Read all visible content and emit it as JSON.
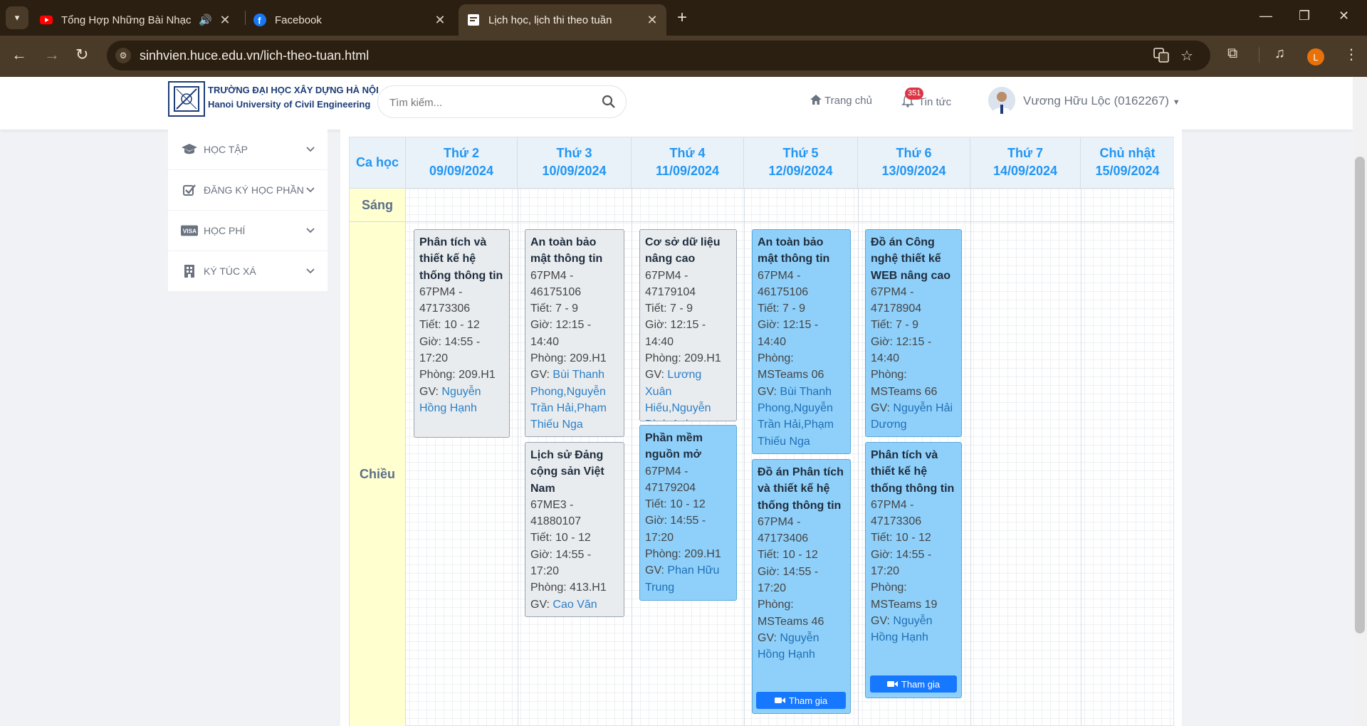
{
  "browser": {
    "tabs": [
      {
        "title": "Tổng Hợp Những Bài Nhạc",
        "icon": "youtube-icon",
        "audio": true
      },
      {
        "title": "Facebook",
        "icon": "facebook-icon"
      },
      {
        "title": "Lịch học, lịch thi theo tuần",
        "icon": "page-icon",
        "active": true
      }
    ],
    "url": "sinhvien.huce.edu.vn/lich-theo-tuan.html",
    "profile_initial": "L"
  },
  "site": {
    "logo_line1": "TRƯỜNG ĐẠI HỌC XÂY DỰNG HÀ NỘI",
    "logo_line2": "Hanoi University of Civil Engineering",
    "search_placeholder": "Tìm kiếm...",
    "nav_home": "Trang chủ",
    "nav_news": "Tin tức",
    "news_count": "351",
    "user_name": "Vương Hữu Lộc (0162267)"
  },
  "sidebar": {
    "items": [
      {
        "label": "HỌC TẬP",
        "icon": "graduation-cap-icon"
      },
      {
        "label": "ĐĂNG KÝ HỌC PHẦN",
        "icon": "checkbox-icon"
      },
      {
        "label": "HỌC PHÍ",
        "icon": "visa-card-icon"
      },
      {
        "label": "KÝ TÚC XÁ",
        "icon": "building-icon"
      }
    ]
  },
  "timetable": {
    "corner": "Ca học",
    "days": [
      {
        "day": "Thứ 2",
        "date": "09/09/2024"
      },
      {
        "day": "Thứ 3",
        "date": "10/09/2024"
      },
      {
        "day": "Thứ 4",
        "date": "11/09/2024"
      },
      {
        "day": "Thứ 5",
        "date": "12/09/2024"
      },
      {
        "day": "Thứ 6",
        "date": "13/09/2024"
      },
      {
        "day": "Thứ 7",
        "date": "14/09/2024"
      },
      {
        "day": "Chủ nhật",
        "date": "15/09/2024"
      }
    ],
    "sessions": {
      "morning": "Sáng",
      "afternoon": "Chiều"
    },
    "join_label": "Tham gia",
    "classes": [
      {
        "title": "Phân tích và thiết kế hệ thống thông tin",
        "code": "67PM4 - 47173306",
        "period": "Tiết: 10 - 12",
        "time": "Giờ: 14:55 - 17:20",
        "room": "Phòng: 209.H1",
        "gv_prefix": "GV: ",
        "gv": "Nguyễn Hồng Hạnh"
      },
      {
        "title": "An toàn bảo mật thông tin",
        "code": "67PM4 - 46175106",
        "period": "Tiết: 7 - 9",
        "time": "Giờ: 12:15 - 14:40",
        "room": "Phòng: 209.H1",
        "gv_prefix": "GV: ",
        "gv": "Bùi Thanh Phong,Nguyễn Trần Hải,Phạm Thiếu Nga"
      },
      {
        "title": "Lịch sử Đảng cộng sản Việt Nam",
        "code": "67ME3 - 41880107",
        "period": "Tiết: 10 - 12",
        "time": "Giờ: 14:55 - 17:20",
        "room": "Phòng: 413.H1",
        "gv_prefix": "GV: ",
        "gv": "Cao Văn Đan"
      },
      {
        "title": "Cơ sở dữ liệu nâng cao",
        "code": "67PM4 - 47179104",
        "period": "Tiết: 7 - 9",
        "time": "Giờ: 12:15 - 14:40",
        "room": "Phòng: 209.H1",
        "gv_prefix": "GV: ",
        "gv": "Lương Xuân Hiếu,Nguyễn Đình Anh"
      },
      {
        "title": "Phần mềm nguồn mở",
        "code": "67PM4 - 47179204",
        "period": "Tiết: 10 - 12",
        "time": "Giờ: 14:55 - 17:20",
        "room": "Phòng: 209.H1",
        "gv_prefix": "GV: ",
        "gv": "Phan Hữu Trung"
      },
      {
        "title": "An toàn bảo mật thông tin",
        "code": "67PM4 - 46175106",
        "period": "Tiết: 7 - 9",
        "time": "Giờ: 12:15 - 14:40",
        "room": "Phòng: MSTeams 06",
        "gv_prefix": "GV: ",
        "gv": "Bùi Thanh Phong,Nguyễn Trần Hải,Phạm Thiếu Nga"
      },
      {
        "title": "Đồ án Phân tích và thiết kế hệ thống thông tin",
        "code": "67PM4 - 47173406",
        "period": "Tiết: 10 - 12",
        "time": "Giờ: 14:55 - 17:20",
        "room": "Phòng: MSTeams 46",
        "gv_prefix": "GV: ",
        "gv": "Nguyễn Hồng Hạnh"
      },
      {
        "title": "Đồ án Công nghệ thiết kế WEB nâng cao",
        "code": "67PM4 - 47178904",
        "period": "Tiết: 7 - 9",
        "time": "Giờ: 12:15 - 14:40",
        "room": "Phòng: MSTeams 66",
        "gv_prefix": "GV: ",
        "gv": "Nguyễn Hải Dương"
      },
      {
        "title": "Phân tích và thiết kế hệ thống thông tin",
        "code": "67PM4 - 47173306",
        "period": "Tiết: 10 - 12",
        "time": "Giờ: 14:55 - 17:20",
        "room": "Phòng: MSTeams 19",
        "gv_prefix": "GV: ",
        "gv": "Nguyễn Hồng Hạnh"
      }
    ]
  },
  "colors": {
    "header_blue": "#2196f3",
    "card_grey": "#e9ecef",
    "card_online": "#8fd0fa",
    "join_button": "#1677ff",
    "session_label_bg": "#ffffd0"
  }
}
